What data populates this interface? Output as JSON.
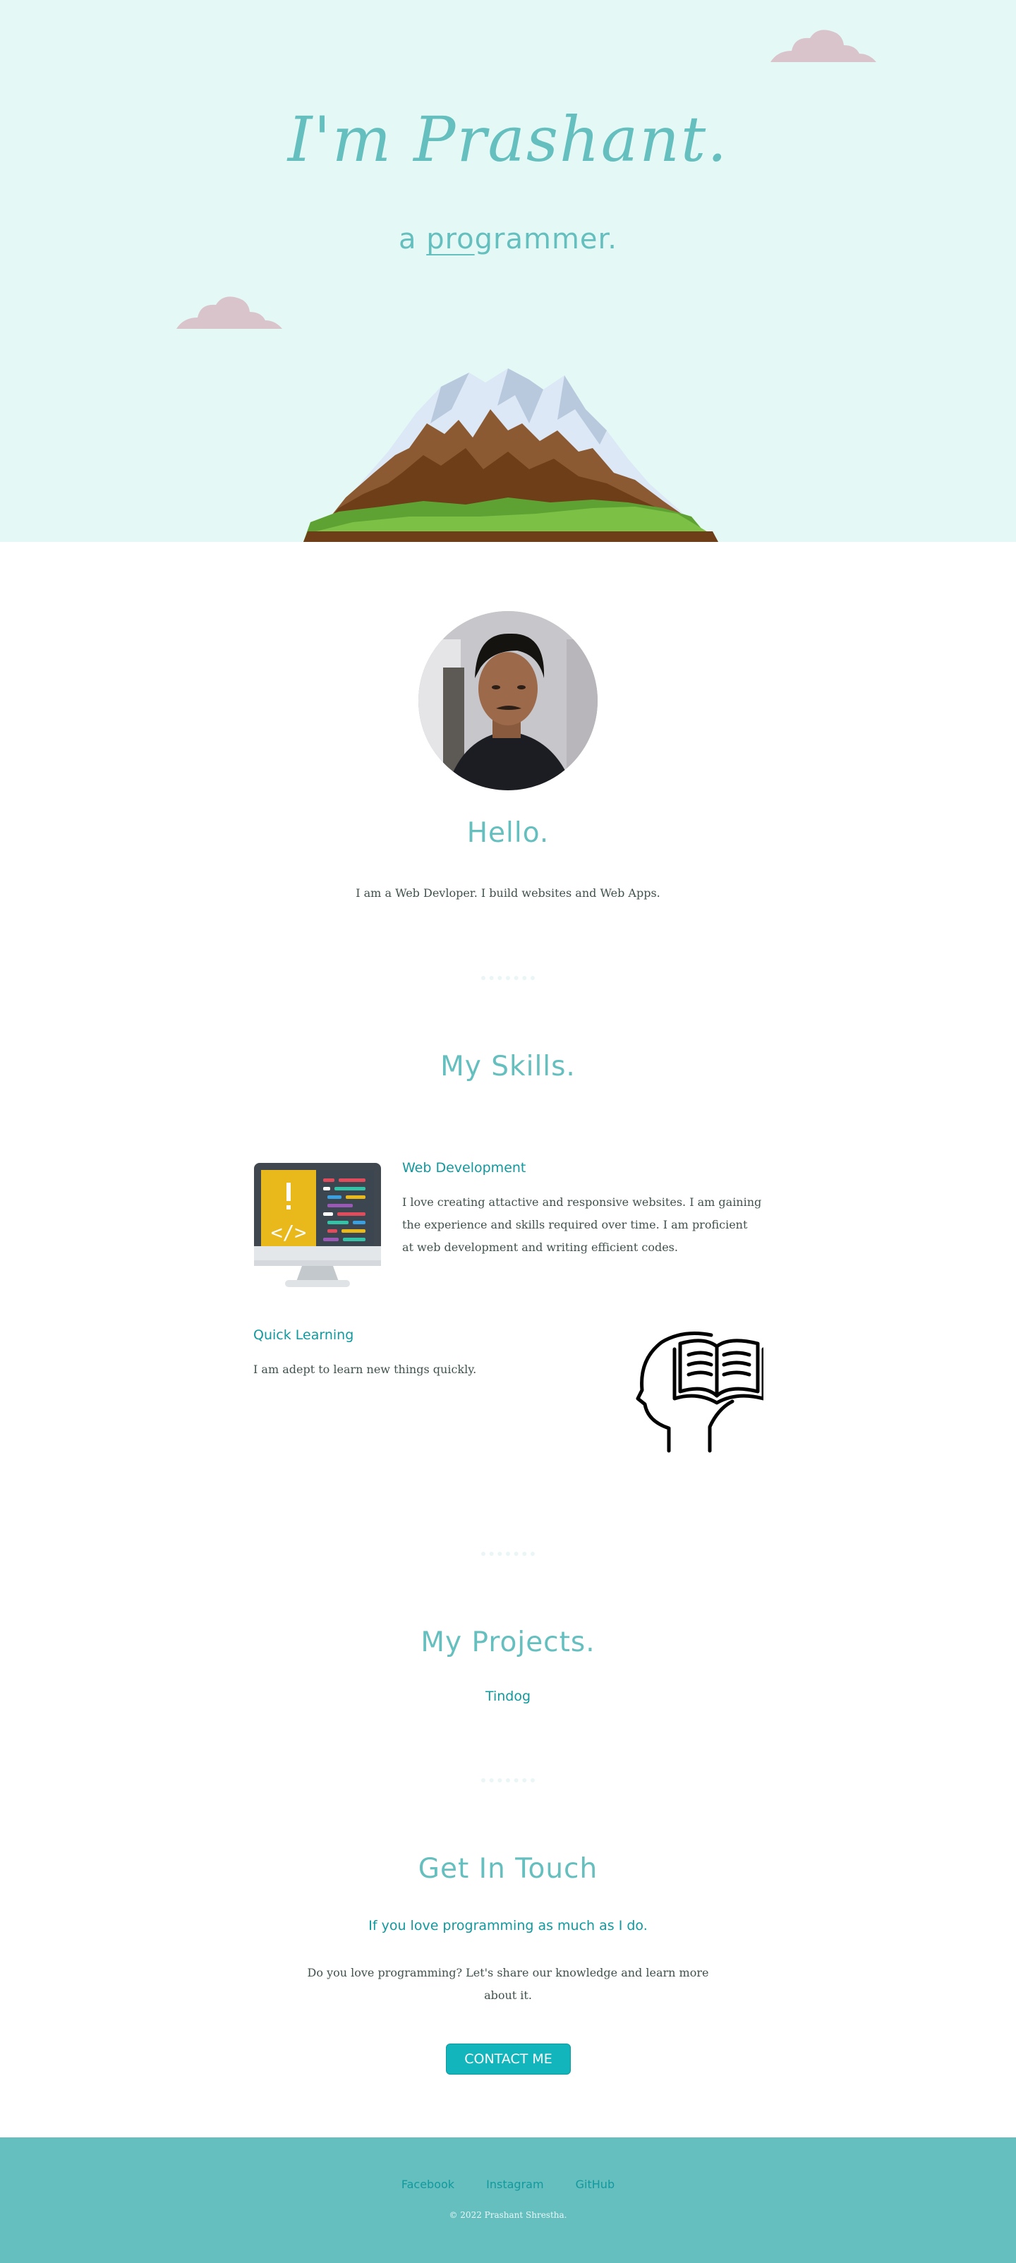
{
  "hero": {
    "title": "I'm Prashant.",
    "subtitle_prefix": "a ",
    "subtitle_underlined": "pro",
    "subtitle_suffix": "grammer."
  },
  "about": {
    "heading": "Hello.",
    "text": "I am a Web Devloper. I build websites and Web Apps."
  },
  "skills": {
    "heading": "My Skills.",
    "items": [
      {
        "title": "Web Development",
        "text": "I love creating attactive and responsive websites. I am gaining the experience and skills required over time. I am proficient at web development and writing efficient codes.",
        "icon": "computer-code-icon"
      },
      {
        "title": "Quick Learning",
        "text": "I am adept to learn new things quickly.",
        "icon": "head-book-icon"
      }
    ]
  },
  "projects": {
    "heading": "My Projects.",
    "items": [
      {
        "title": "Tindog"
      }
    ]
  },
  "contact": {
    "heading": "Get In Touch",
    "subheading": "If you love programming as much as I do.",
    "text": "Do you love programming? Let's share our knowledge and learn more about it.",
    "button_label": "CONTACT ME"
  },
  "footer": {
    "links": [
      "Facebook",
      "Instagram",
      "GitHub"
    ],
    "copyright": "© 2022 Prashant Shrestha."
  },
  "colors": {
    "hero_bg": "#e4f9f5",
    "accent": "#66bfbf",
    "heading_dark": "#11999e",
    "text": "#40514e",
    "button": "#11b5bb"
  }
}
